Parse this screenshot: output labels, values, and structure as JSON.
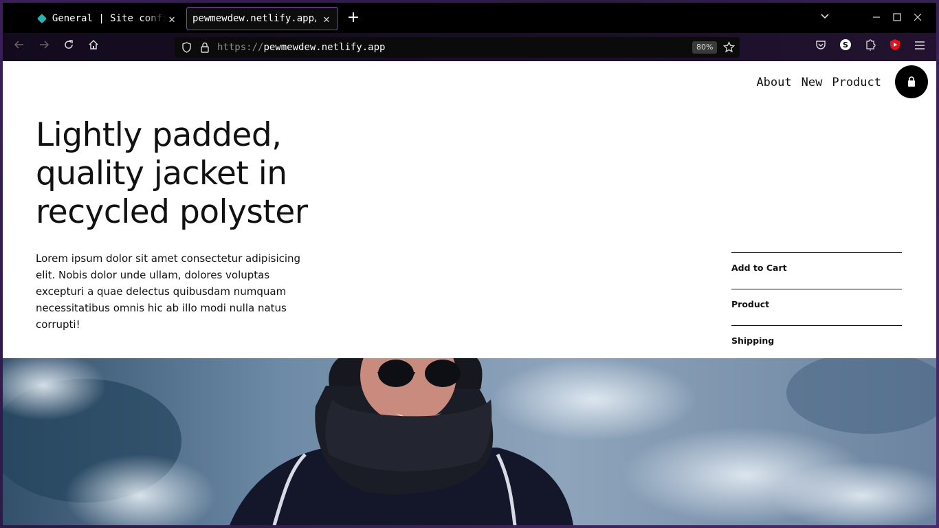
{
  "browser": {
    "tabs": [
      {
        "title": "General | Site configuration"
      },
      {
        "title": "pewmewdew.netlify.app/"
      }
    ],
    "url_protocol": "https://",
    "url_host": "pewmewdew.netlify.app",
    "zoom": "80%"
  },
  "site": {
    "nav": [
      "About",
      "New",
      "Product"
    ],
    "hero_title": "Lightly padded, quality jacket in recycled polyster",
    "hero_description": "Lorem ipsum dolor sit amet consectetur adipisicing elit. Nobis dolor unde ullam, dolores voluptas excepturi a quae delectus quibusdam numquam necessitatibus omnis hic ab illo modi nulla natus corrupti!",
    "accordion": [
      "Add to Cart",
      "Product",
      "Shipping"
    ]
  },
  "colors": {
    "tab_active_border": "#8a3fc9",
    "favicon": "#2bb3b1"
  }
}
